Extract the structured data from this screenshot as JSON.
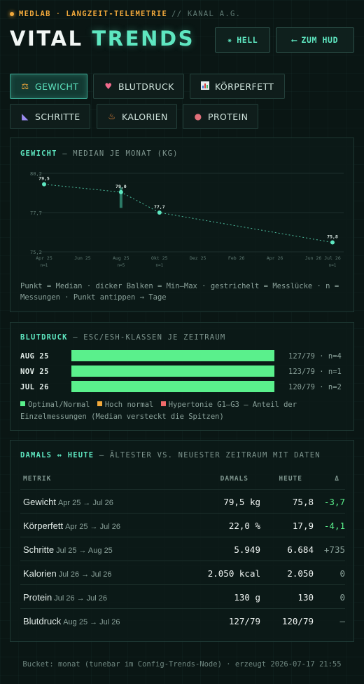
{
  "header": {
    "brand": "MEDLAB",
    "subtitle": "LANGZEIT-TELEMETRIE",
    "channel": "// KANAL A.G.",
    "title_part1": "VITAL",
    "title_part2": "TRENDS",
    "btn_hell": "HELL",
    "btn_hud": "ZUM HUD",
    "accent_color": "#5ee6c0",
    "brand_color": "#f2a93b"
  },
  "tabs": [
    {
      "label": "GEWICHT",
      "icon": "scale-icon",
      "glyph": "⚖",
      "active": true
    },
    {
      "label": "BLUTDRUCK",
      "icon": "heart-icon",
      "glyph": "♥",
      "active": false
    },
    {
      "label": "KÖRPERFETT",
      "icon": "bar-chart-icon",
      "glyph": "▮",
      "active": false
    },
    {
      "label": "SCHRITTE",
      "icon": "shoe-icon",
      "glyph": "◣",
      "active": false
    },
    {
      "label": "KALORIEN",
      "icon": "flame-icon",
      "glyph": "♨",
      "active": false
    },
    {
      "label": "PROTEIN",
      "icon": "meat-icon",
      "glyph": "●",
      "active": false
    }
  ],
  "weight_panel": {
    "title_key": "GEWICHT",
    "title_rest": "— MEDIAN JE MONAT (KG)",
    "note": "Punkt = Median · dicker Balken = Min–Max · gestrichelt = Messlücke · n = Messungen · Punkt antippen → Tage"
  },
  "chart_data": {
    "type": "line",
    "title": "GEWICHT — MEDIAN JE MONAT (KG)",
    "x_ticks": [
      "Apr 25",
      "Jun 25",
      "Aug 25",
      "Okt 25",
      "Dez 25",
      "Feb 26",
      "Apr 26",
      "Jun 26",
      "Jul 26"
    ],
    "y_ticks": [
      "80,2",
      "77,7",
      "75,2"
    ],
    "ylim": [
      75.2,
      80.2
    ],
    "grid": true,
    "points": [
      {
        "x": "Apr 25",
        "y": 79.5,
        "label": "79,5",
        "n": "n=1"
      },
      {
        "x": "Aug 25",
        "y": 79.0,
        "label": "79,0",
        "n": "n=5",
        "min": 78.0,
        "max": 79.3
      },
      {
        "x": "Okt 25",
        "y": 77.7,
        "label": "77,7",
        "n": "n=1"
      },
      {
        "x": "Jul 26",
        "y": 75.8,
        "label": "75,8",
        "n": "n=1"
      }
    ],
    "line_style": "dashed",
    "color": "#5ee6c0"
  },
  "bp_panel": {
    "title_key": "BLUTDRUCK",
    "title_rest": "— ESC/ESH-KLASSEN JE ZEITRAUM",
    "rows": [
      {
        "label": "AUG 25",
        "value": "127/79 · n=4",
        "optimal_share": 1.0
      },
      {
        "label": "NOV 25",
        "value": "123/79 · n=1",
        "optimal_share": 1.0
      },
      {
        "label": "JUL 26",
        "value": "120/79 · n=2",
        "optimal_share": 1.0
      }
    ],
    "legend_optimal": "Optimal/Normal",
    "legend_high": "Hoch normal",
    "legend_hyper": "Hypertonie G1–G3",
    "legend_tail": "— Anteil der Einzelmessungen (Median versteckt die Spitzen)",
    "color_optimal": "#5af08c",
    "color_high": "#f2a93b",
    "color_hyper": "#f06a6a"
  },
  "compare_panel": {
    "title_key": "DAMALS ↔ HEUTE",
    "title_rest": "— ÄLTESTER VS. NEUESTER ZEITRAUM MIT DATEN",
    "col_metric": "METRIK",
    "col_then": "DAMALS",
    "col_now": "HEUTE",
    "col_delta": "Δ",
    "rows": [
      {
        "metric": "Gewicht",
        "period": "Apr 25 → Jul 26",
        "then": "79,5 kg",
        "now": "75,8",
        "delta": "-3,7",
        "delta_color": "#5af08c"
      },
      {
        "metric": "Körperfett",
        "period": "Apr 25 → Jul 26",
        "then": "22,0 %",
        "now": "17,9",
        "delta": "-4,1",
        "delta_color": "#5af08c"
      },
      {
        "metric": "Schritte",
        "period": "Jul 25 → Aug 25",
        "then": "5.949",
        "now": "6.684",
        "delta": "+735",
        "delta_color": "#8aa19a"
      },
      {
        "metric": "Kalorien",
        "period": "Jul 26 → Jul 26",
        "then": "2.050 kcal",
        "now": "2.050",
        "delta": "0",
        "delta_color": "#8aa19a"
      },
      {
        "metric": "Protein",
        "period": "Jul 26 → Jul 26",
        "then": "130 g",
        "now": "130",
        "delta": "0",
        "delta_color": "#8aa19a"
      },
      {
        "metric": "Blutdruck",
        "period": "Aug 25 → Jul 26",
        "then": "127/79",
        "now": "120/79",
        "delta": "—",
        "delta_color": "#8aa19a"
      }
    ]
  },
  "footer": {
    "text": "Bucket: monat (tunebar im Config-Trends-Node) · erzeugt 2026-07-17 21:55"
  }
}
